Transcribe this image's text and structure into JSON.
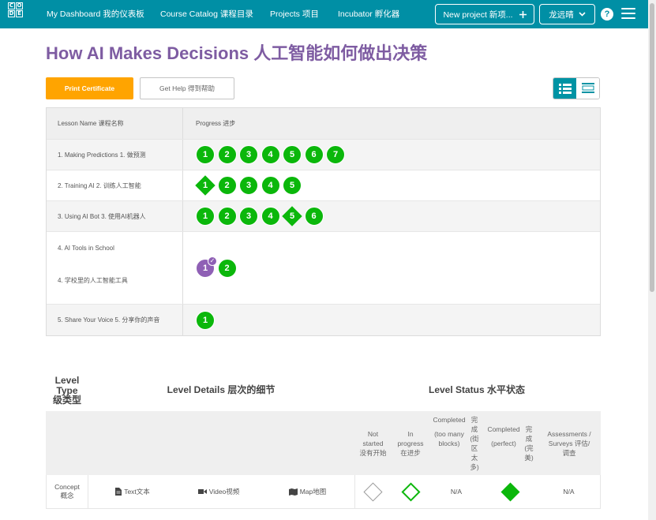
{
  "nav": {
    "logo_letters": [
      "C",
      "O",
      "",
      "D",
      "E",
      ""
    ],
    "dashboard": "My Dashboard 我的仪表板",
    "catalog": "Course Catalog 课程目录",
    "projects": "Projects 项目",
    "incubator": "Incubator 孵化器",
    "new_project": "New project 新项...",
    "new_project_icon": "plus-icon",
    "user": "龙远晴",
    "help": "?"
  },
  "page_title": "How AI Makes Decisions 人工智能如何做出决策",
  "buttons": {
    "print": "Print Certificate",
    "help": "Get Help 得到帮助"
  },
  "progress_table": {
    "col_name": "Lesson Name 课程名称",
    "col_progress": "Progress 进步",
    "lessons": [
      {
        "name": "1. Making Predictions 1. 做预测",
        "levels": [
          {
            "n": "1",
            "kind": "circle"
          },
          {
            "n": "2",
            "kind": "circle"
          },
          {
            "n": "3",
            "kind": "circle"
          },
          {
            "n": "4",
            "kind": "circle"
          },
          {
            "n": "5",
            "kind": "circle"
          },
          {
            "n": "6",
            "kind": "circle"
          },
          {
            "n": "7",
            "kind": "circle"
          }
        ]
      },
      {
        "name": "2. Training AI 2. 训练人工智能",
        "levels": [
          {
            "n": "1",
            "kind": "diamond"
          },
          {
            "n": "2",
            "kind": "circle"
          },
          {
            "n": "3",
            "kind": "circle"
          },
          {
            "n": "4",
            "kind": "circle"
          },
          {
            "n": "5",
            "kind": "circle"
          }
        ]
      },
      {
        "name": "3. Using AI Bot 3. 使用AI机器人",
        "levels": [
          {
            "n": "1",
            "kind": "circle"
          },
          {
            "n": "2",
            "kind": "circle"
          },
          {
            "n": "3",
            "kind": "circle"
          },
          {
            "n": "4",
            "kind": "circle"
          },
          {
            "n": "5",
            "kind": "diamond"
          },
          {
            "n": "6",
            "kind": "circle"
          }
        ]
      },
      {
        "name": "4. AI Tools in School",
        "name2": "4. 学校里的人工智能工具",
        "levels": [
          {
            "n": "1",
            "kind": "purple"
          },
          {
            "n": "2",
            "kind": "circle"
          }
        ]
      },
      {
        "name": "5. Share Your Voice 5. 分享你的声音",
        "levels": [
          {
            "n": "1",
            "kind": "circle"
          }
        ]
      }
    ]
  },
  "legend": {
    "level_type_1": "Level",
    "level_type_2": "Type",
    "level_type_3": "级类型",
    "level_details": "Level Details 层次的细节",
    "level_status": "Level Status 水平状态",
    "status_cols": {
      "not_started": "Not started 没有开始",
      "in_progress": "In progress 在进步",
      "completed_too_many_a": "Completed",
      "completed_too_many_b": "(too many blocks)",
      "completed_too_many_zh": "完成 (街区太多)",
      "completed_perfect_a": "Completed",
      "completed_perfect_b": "(perfect)",
      "completed_perfect_zh": "完成 (完美)",
      "assessments": "Assessments / Surveys 评估/调查"
    },
    "row": {
      "type": "Concept 概念",
      "text": "Text文本",
      "video": "Video视频",
      "map": "Map地图",
      "too_many": "N/A",
      "assessment": "N/A"
    }
  },
  "colors": {
    "nav": "#008fa5",
    "title": "#7e5ca2",
    "print": "#ffa400",
    "complete": "#0bb70b",
    "assessment": "#8f60b5"
  }
}
